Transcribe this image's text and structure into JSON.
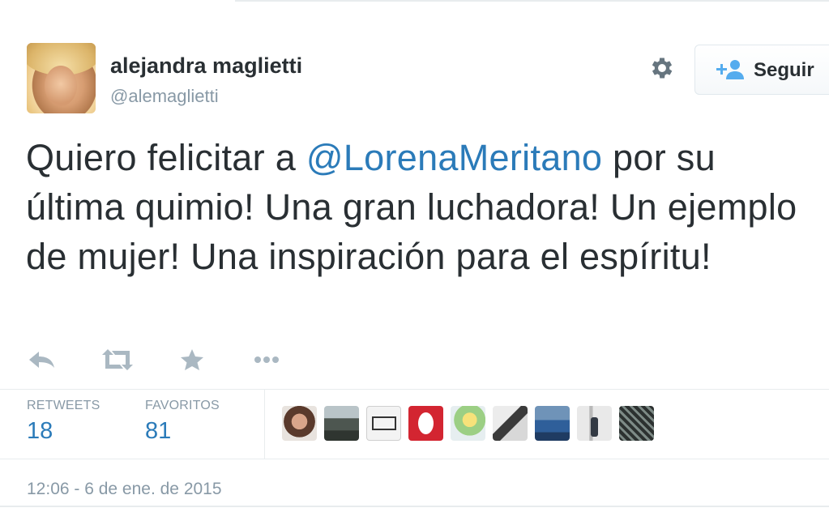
{
  "author": {
    "name": "alejandra maglietti",
    "handle": "@alemaglietti"
  },
  "follow_button": {
    "label": "Seguir",
    "icon": "add-user-icon"
  },
  "settings_icon": "gear-icon",
  "tweet": {
    "text_before": "Quiero felicitar a ",
    "mention": "@LorenaMeritano",
    "text_after": " por su última quimio! Una gran luchadora! Un ejemplo de mujer! Una inspiración para el espíritu!"
  },
  "actions": [
    "reply-icon",
    "retweet-icon",
    "favorite-star-icon",
    "more-dots-icon"
  ],
  "stats": {
    "retweets_label": "RETWEETS",
    "retweets_value": "18",
    "favorites_label": "FAVORITOS",
    "favorites_value": "81"
  },
  "favoriters_count_shown": 9,
  "timestamp": "12:06 - 6 de ene. de 2015",
  "colors": {
    "text": "#292f33",
    "muted": "#8899a6",
    "link": "#2b7bb9",
    "border": "#e1e8ed"
  }
}
